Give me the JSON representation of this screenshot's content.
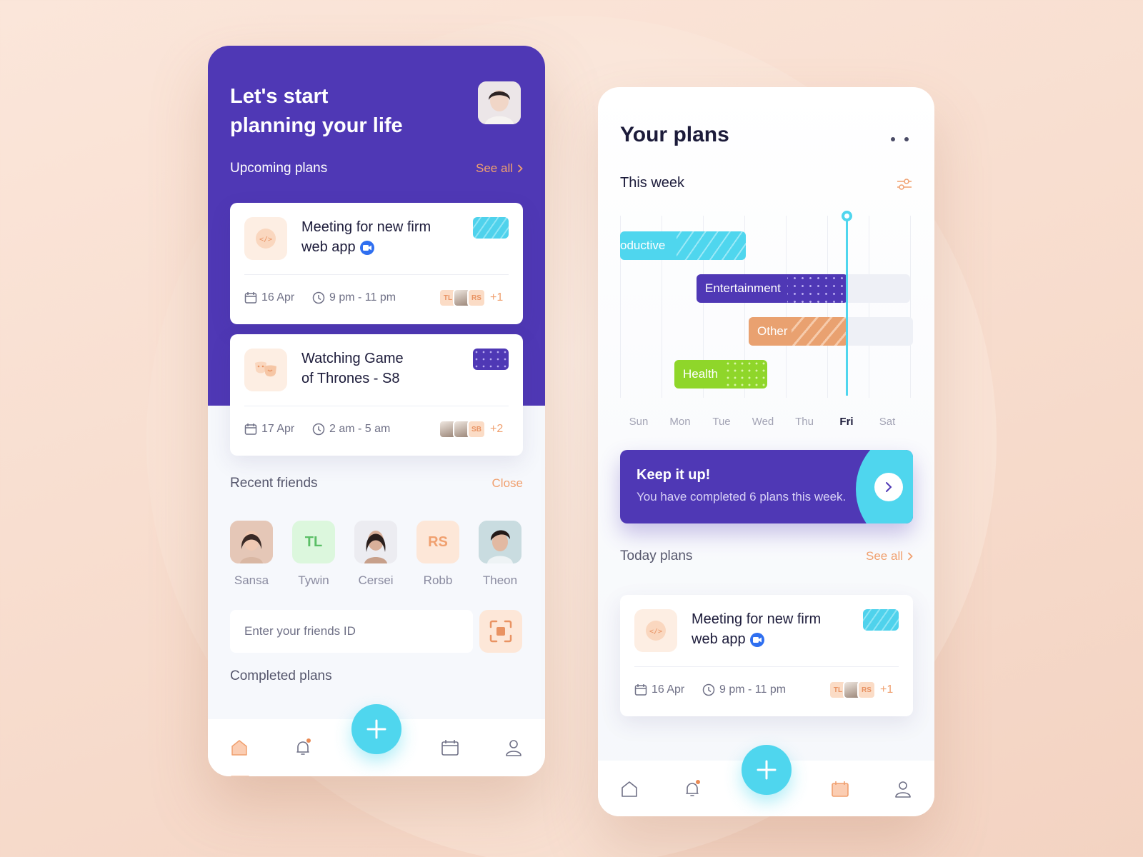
{
  "left": {
    "hero_title_line1": "Let's start",
    "hero_title_line2": "planning your life",
    "upcoming": {
      "title": "Upcoming plans",
      "see_all": "See all",
      "cards": [
        {
          "title_line1": "Meeting for new firm",
          "title_line2": "web app",
          "icon": "code-icon",
          "date": "16 Apr",
          "time": "9 pm - 11 pm",
          "avatars": [
            "TL",
            "photo",
            "RS"
          ],
          "extra": "+1",
          "tag": "cyan-striped"
        },
        {
          "title_line1": "Watching Game",
          "title_line2": "of Thrones - S8",
          "icon": "theater-masks-icon",
          "date": "17 Apr",
          "time": "2 am - 5 am",
          "avatars": [
            "photo",
            "photo",
            "SB"
          ],
          "extra": "+2",
          "tag": "purple-dotted"
        }
      ]
    },
    "recent_friends": {
      "title": "Recent friends",
      "action": "Close",
      "friends": [
        {
          "name": "Sansa",
          "initials": "",
          "type": "photo"
        },
        {
          "name": "Tywin",
          "initials": "TL",
          "type": "initials",
          "bg": "#dcf7dd",
          "fg": "#5bbf66"
        },
        {
          "name": "Cersei",
          "initials": "",
          "type": "photo"
        },
        {
          "name": "Robb",
          "initials": "RS",
          "type": "initials",
          "bg": "#fde7d8",
          "fg": "#f0a06f"
        },
        {
          "name": "Theon",
          "initials": "",
          "type": "photo"
        }
      ]
    },
    "friend_id_placeholder": "Enter your friends ID",
    "completed": {
      "title": "Completed plans"
    },
    "tabs": [
      "home-icon",
      "bell-icon",
      "add-icon",
      "calendar-icon",
      "user-icon"
    ],
    "active_tab": "home-icon"
  },
  "right": {
    "title": "Your plans",
    "week_title": "This week",
    "gantt": {
      "days": [
        "Sun",
        "Mon",
        "Tue",
        "Wed",
        "Thu",
        "Fri",
        "Sat"
      ],
      "current_day": "Fri",
      "bars": [
        {
          "label": "Productive",
          "visible_label": "oductive",
          "color": "#4fd6ee"
        },
        {
          "label": "Entertainment",
          "color": "#4f38b5"
        },
        {
          "label": "Other",
          "color": "#f0a06f"
        },
        {
          "label": "Health",
          "color": "#8fd62a"
        }
      ]
    },
    "keep_up": {
      "title": "Keep it up!",
      "subtitle": "You have completed 6 plans this week."
    },
    "today": {
      "title": "Today plans",
      "see_all": "See all",
      "card": {
        "title_line1": "Meeting for new firm",
        "title_line2": "web app",
        "date": "16 Apr",
        "time": "9 pm - 11 pm",
        "avatars": [
          "TL",
          "photo",
          "RS"
        ],
        "extra": "+1"
      }
    },
    "tabs": [
      "home-icon",
      "bell-icon",
      "add-icon",
      "calendar-icon",
      "user-icon"
    ],
    "active_tab": "calendar-icon"
  },
  "colors": {
    "primary": "#4f38b5",
    "accent": "#4fd6ee",
    "orange": "#f0a06f",
    "green": "#8fd62a"
  }
}
